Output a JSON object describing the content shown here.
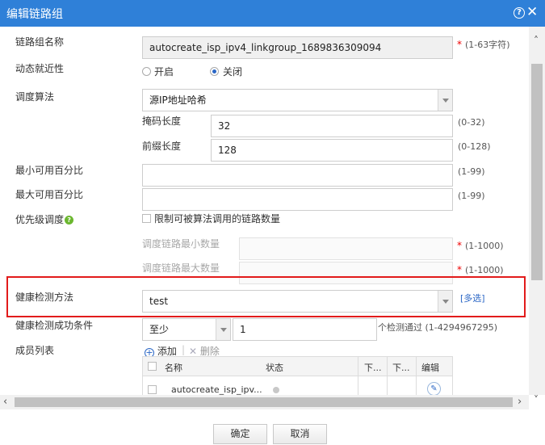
{
  "dialog": {
    "title": "编辑链路组"
  },
  "form": {
    "name": {
      "label": "链路组名称",
      "value": "autocreate_isp_ipv4_linkgroup_1689836309094",
      "required": "*",
      "hint": "(1-63字符)"
    },
    "nearest": {
      "label": "动态就近性",
      "option_on": "开启",
      "option_off": "关闭",
      "selected": "关闭"
    },
    "algorithm": {
      "label": "调度算法",
      "value": "源IP地址哈希",
      "mask": {
        "label": "掩码长度",
        "value": "32",
        "hint": "(0-32)"
      },
      "prefix": {
        "label": "前缀长度",
        "value": "128",
        "hint": "(0-128)"
      }
    },
    "min_percent": {
      "label": "最小可用百分比",
      "value": "",
      "hint": "(1-99)"
    },
    "max_percent": {
      "label": "最大可用百分比",
      "value": "",
      "hint": "(1-99)"
    },
    "priority": {
      "label": "优先级调度",
      "checkbox_label": "限制可被算法调用的链路数量",
      "min_links": {
        "label": "调度链路最小数量",
        "value": "",
        "required": "*",
        "hint": "(1-1000)"
      },
      "max_links": {
        "label": "调度链路最大数量",
        "value": "",
        "required": "*",
        "hint": "(1-1000)"
      }
    },
    "health_method": {
      "label": "健康检测方法",
      "value": "test",
      "multi_link": "[多选]"
    },
    "health_condition": {
      "label": "健康检测成功条件",
      "mode": "至少",
      "count": "1",
      "suffix": "个检测通过",
      "hint": "(1-4294967295)"
    },
    "members": {
      "label": "成员列表",
      "add_label": "添加",
      "delete_label": "删除",
      "columns": [
        "名称",
        "状态",
        "下...",
        "下...",
        "编辑"
      ],
      "rows": [
        {
          "name": "autocreate_isp_ipv..."
        }
      ]
    }
  },
  "footer": {
    "ok_label": "确定",
    "cancel_label": "取消"
  },
  "colors": {
    "title_bar": "#2f80d8",
    "highlight_border": "#e21b1b",
    "link": "#2b67c6"
  }
}
